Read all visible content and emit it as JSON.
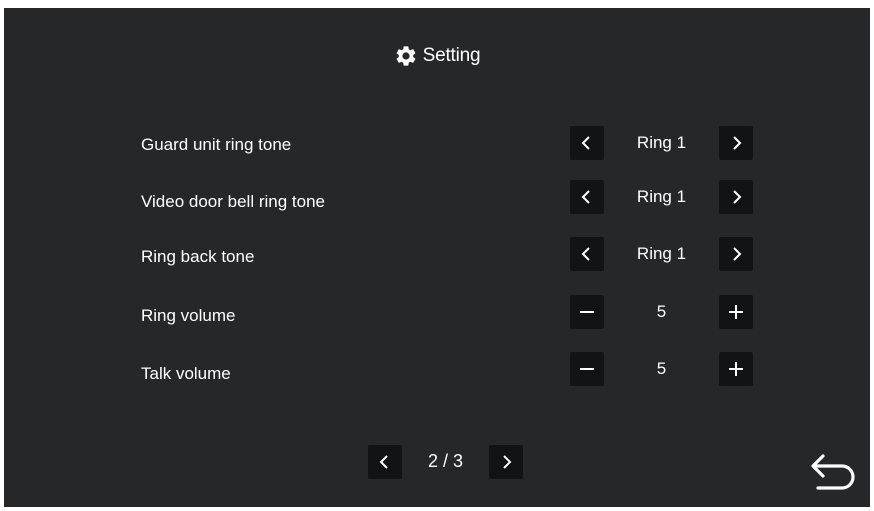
{
  "header": {
    "title": "Setting",
    "icon": "gear-icon"
  },
  "settings": [
    {
      "label": "Guard unit ring tone",
      "value": "Ring 1",
      "control": "arrows"
    },
    {
      "label": "Video door bell ring tone",
      "value": "Ring 1",
      "control": "arrows"
    },
    {
      "label": "Ring back tone",
      "value": "Ring 1",
      "control": "arrows"
    },
    {
      "label": "Ring volume",
      "value": "5",
      "control": "stepper"
    },
    {
      "label": "Talk volume",
      "value": "5",
      "control": "stepper"
    }
  ],
  "pagination": {
    "page": "2 / 3"
  },
  "colors": {
    "background": "#262729",
    "button": "#121314",
    "text": "#ffffff"
  }
}
